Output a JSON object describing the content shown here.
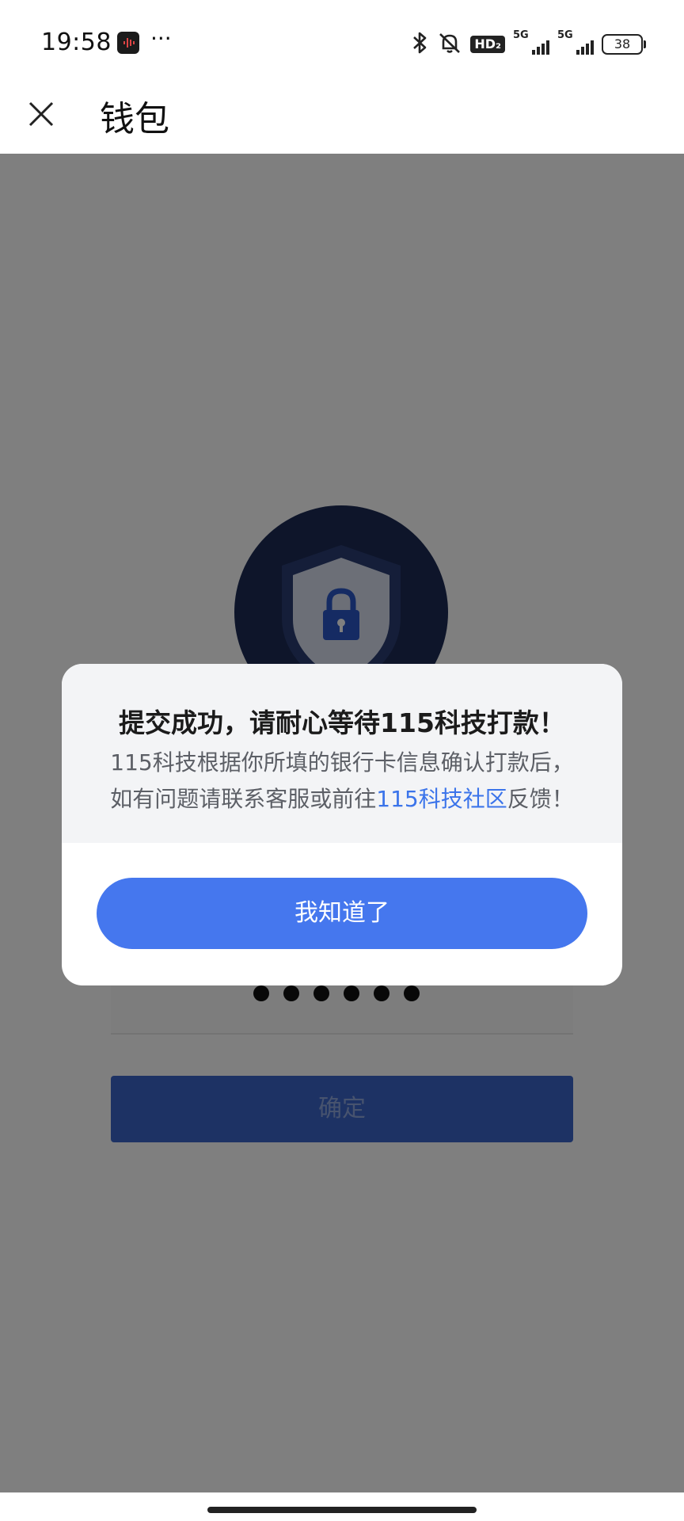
{
  "status_bar": {
    "time": "19:58",
    "more": "···",
    "bluetooth_icon": "bluetooth-icon",
    "mute_icon": "bell-off-icon",
    "hd_label": "HD₂",
    "network1": "5G",
    "network2": "5G",
    "battery": "38"
  },
  "header": {
    "title": "钱包"
  },
  "page": {
    "confirm_label": "确定"
  },
  "dialog": {
    "title": "提交成功，请耐心等待115科技打款！",
    "message_line1": "115科技根据你所填的银行卡信息确认打款后，",
    "message_line2_prefix": "如有问题请联系客服或前往",
    "message_link": "115科技社区",
    "message_line2_suffix": "反馈！",
    "ok_label": "我知道了"
  },
  "colors": {
    "accent": "#4577ee",
    "link": "#3b74ea",
    "overlay": "rgba(0,0,0,0.50)"
  }
}
